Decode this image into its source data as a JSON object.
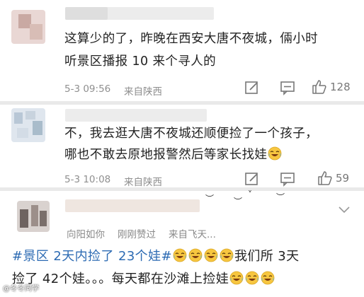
{
  "comments": [
    {
      "text_line1": "这算少的了，昨晚在西安大唐不夜城，倆小时",
      "text_line2": "听景区播报 10 来个寻人的",
      "time": "5-3 09:56",
      "source": "来自陕西",
      "likes": "128"
    },
    {
      "text_line1": "不，我去逛大唐不夜城还顺便捡了一个孩子，",
      "text_line2": "哪也不敢去原地报警然后等家长找娃",
      "time": "5-3 10:08",
      "source": "来自陕西",
      "likes": "59"
    }
  ],
  "post": {
    "author_meta": [
      "向阳如你",
      "刚刚赞过",
      "来自飞天..."
    ],
    "hashtag": "#景区 2天内捡了 23个娃#",
    "text_line1_tail": "我们所 3天",
    "text_line2": "捡了 42个娃。。。每天都在沙滩上捡娃",
    "watermark": "@冬冬同学"
  },
  "icons": {
    "edit": "edit-icon",
    "comment": "comment-icon",
    "like": "thumbs-up-icon",
    "emoji": "laughing-tears-emoji",
    "chevron": "chevron-down-icon"
  }
}
